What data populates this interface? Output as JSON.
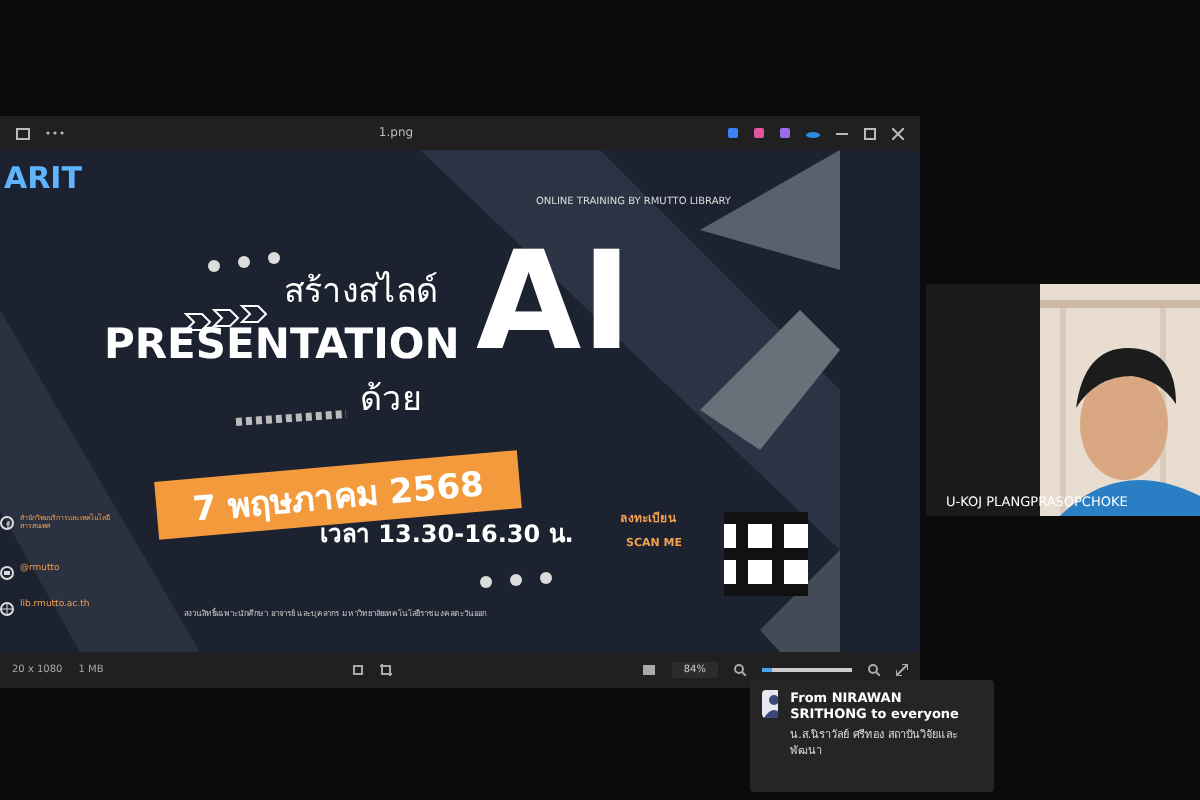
{
  "viewer": {
    "title": "1.png",
    "status": [
      "20 x 1080",
      "1 MB"
    ],
    "zoom": "84%",
    "level": 0.1
  },
  "poster": {
    "logo": "ARIT",
    "tagline": "ONLINE TRAINING BY RMUTTO LIBRARY",
    "title_thai": "สร้างสไลด์",
    "title_en": "PRESENTATION",
    "title_with": "ด้วย",
    "title_ai": "AI",
    "date": "7 พฤษภาคม 2568",
    "time": "เวลา 13.30-16.30 น.",
    "register": "ลงทะเบียน",
    "scan": "SCAN ME",
    "contacts": [
      {
        "kind": "facebook",
        "text": "สำนักวิทยบริการและเทคโนโลยีสารสนเทศ"
      },
      {
        "kind": "line",
        "text": "@rmutto"
      },
      {
        "kind": "web",
        "text": "lib.rmutto.ac.th"
      }
    ],
    "footer": "สงวนสิทธิ์เฉพาะนักศึกษา อาจารย์ และบุคลากร มหาวิทยาลัยเทคโนโลยีราชมงคลตะวันออก"
  },
  "participant": {
    "name": "U-KOJ PLANGPRASOPCHOKE"
  },
  "chat": {
    "from": "From NIRAWAN SRITHONG to everyone",
    "message": "น.ส.นิราวัลย์ ศรีทอง สถาบันวิจัยและพัฒนา"
  }
}
